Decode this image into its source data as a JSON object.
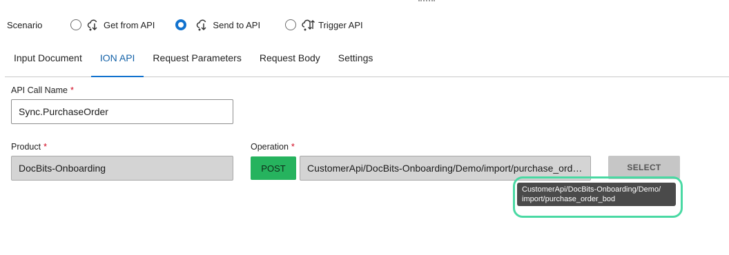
{
  "scenario": {
    "label": "Scenario",
    "options": [
      {
        "label": "Get from API",
        "icon": "cloud-download-icon",
        "selected": false
      },
      {
        "label": "Send to API",
        "icon": "cloud-upload-icon",
        "selected": true
      },
      {
        "label": "Trigger API",
        "icon": "cloud-sync-icon",
        "selected": false
      }
    ]
  },
  "tabs": [
    {
      "label": "Input Document",
      "active": false
    },
    {
      "label": "ION API",
      "active": true
    },
    {
      "label": "Request Parameters",
      "active": false
    },
    {
      "label": "Request Body",
      "active": false
    },
    {
      "label": "Settings",
      "active": false
    }
  ],
  "form": {
    "api_call_name_label": "API Call Name",
    "api_call_name_value": "Sync.PurchaseOrder",
    "product_label": "Product",
    "product_value": "DocBits-Onboarding",
    "operation_label": "Operation",
    "operation_method": "POST",
    "operation_value": "CustomerApi/DocBits-Onboarding/Demo/import/purchase_order_bod",
    "required_mark": "*",
    "select_button": "SELECT"
  },
  "tooltip": {
    "line1": "CustomerApi/DocBits-Onboarding/Demo/",
    "line2": "import/purchase_order_bod"
  },
  "colors": {
    "accent": "#1172ce",
    "post_green": "#26b35e",
    "required_red": "#d0021b",
    "highlight": "#49d9a3"
  }
}
